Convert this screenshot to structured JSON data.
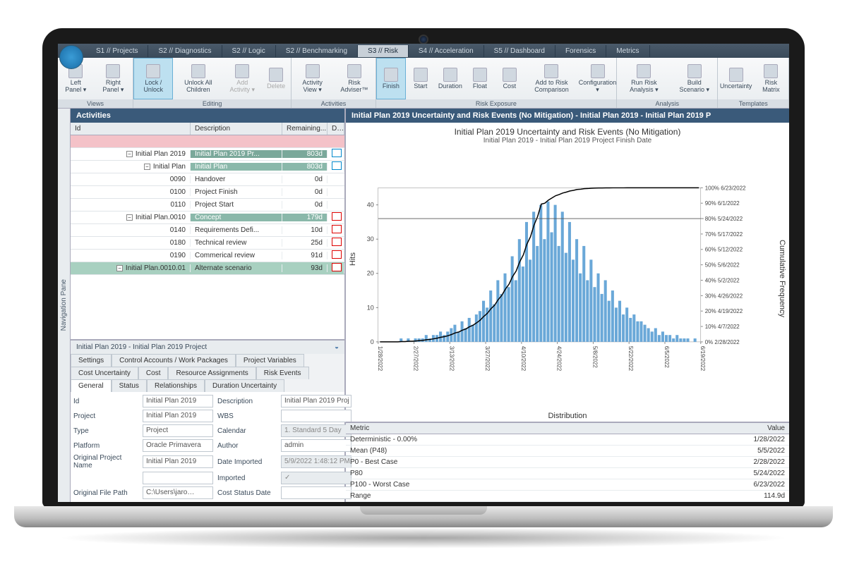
{
  "tabs": [
    "S1 // Projects",
    "S2 // Diagnostics",
    "S2 // Logic",
    "S2 // Benchmarking",
    "S3 // Risk",
    "S4 // Acceleration",
    "S5 // Dashboard",
    "Forensics",
    "Metrics"
  ],
  "active_tab": 4,
  "ribbon": {
    "groups": [
      {
        "label": "Views",
        "items": [
          {
            "t": "Left Panel ▾"
          },
          {
            "t": "Right Panel ▾"
          }
        ]
      },
      {
        "label": "Editing",
        "items": [
          {
            "t": "Lock / Unlock",
            "active": true
          },
          {
            "t": "Unlock All Children"
          },
          {
            "t": "Add Activity ▾",
            "disabled": true
          },
          {
            "t": "Delete",
            "disabled": true
          }
        ]
      },
      {
        "label": "Activities",
        "items": [
          {
            "t": "Activity View ▾"
          },
          {
            "t": "Risk Adviser™"
          }
        ]
      },
      {
        "label": "Risk Exposure",
        "items": [
          {
            "t": "Finish",
            "active": true
          },
          {
            "t": "Start"
          },
          {
            "t": "Duration"
          },
          {
            "t": "Float"
          },
          {
            "t": "Cost"
          },
          {
            "t": "Add to Risk Comparison"
          },
          {
            "t": "Configuration ▾"
          }
        ]
      },
      {
        "label": "Analysis",
        "items": [
          {
            "t": "Run Risk Analysis ▾"
          },
          {
            "t": "Build Scenario ▾"
          }
        ]
      },
      {
        "label": "Templates",
        "items": [
          {
            "t": "Uncertainty"
          },
          {
            "t": "Risk Matrix"
          }
        ]
      }
    ]
  },
  "activities": {
    "title": "Activities",
    "cols": [
      "Id",
      "Description",
      "Remaining...",
      "D…"
    ],
    "rows": [
      {
        "cls": "pink",
        "id": "",
        "desc": "",
        "rem": "",
        "ind": ""
      },
      {
        "cls": "summary",
        "indent": 0,
        "id": "Initial  Plan 2019",
        "desc": "Initial  Plan 2019 Pr...",
        "rem": "803d",
        "ind": "blue"
      },
      {
        "cls": "teal",
        "indent": 1,
        "id": "Initial  Plan",
        "desc": "Initial  Plan",
        "rem": "803d",
        "ind": "blue"
      },
      {
        "cls": "",
        "indent": 2,
        "id": "0090",
        "desc": "Handover",
        "rem": "0d",
        "ind": ""
      },
      {
        "cls": "",
        "indent": 2,
        "id": "0100",
        "desc": "Project Finish",
        "rem": "0d",
        "ind": ""
      },
      {
        "cls": "",
        "indent": 2,
        "id": "0110",
        "desc": "Project Start",
        "rem": "0d",
        "ind": ""
      },
      {
        "cls": "teal",
        "indent": 2,
        "id": "Initial  Plan.0010",
        "desc": "Concept",
        "rem": "179d",
        "ind": "red"
      },
      {
        "cls": "",
        "indent": 3,
        "id": "0140",
        "desc": "Requirements Defi...",
        "rem": "10d",
        "ind": "red"
      },
      {
        "cls": "",
        "indent": 3,
        "id": "0180",
        "desc": "Technical review",
        "rem": "25d",
        "ind": "red"
      },
      {
        "cls": "",
        "indent": 3,
        "id": "0190",
        "desc": "Commerical review",
        "rem": "91d",
        "ind": "red"
      },
      {
        "cls": "green",
        "indent": 3,
        "id": "Initial  Plan.0010.01",
        "desc": "Alternate scenario",
        "rem": "93d",
        "ind": "red"
      }
    ]
  },
  "details": {
    "title": "Initial  Plan 2019 - Initial  Plan 2019 Project",
    "tabrow1": [
      "Settings",
      "Control Accounts / Work Packages",
      "Project Variables"
    ],
    "tabrow2": [
      "Cost Uncertainty",
      "Cost",
      "Resource Assignments",
      "Risk Events"
    ],
    "tabrow3": [
      "General",
      "Status",
      "Relationships",
      "Duration Uncertainty"
    ],
    "active_tab": "General",
    "fields": [
      [
        "Id",
        "Initial  Plan 2019",
        "Description",
        "Initial  Plan 2019 Proj"
      ],
      [
        "Project",
        "Initial  Plan 2019",
        "WBS",
        ""
      ],
      [
        "Type",
        "Project",
        "Calendar",
        "1. Standard 5 Day"
      ],
      [
        "Platform",
        "Oracle Primavera",
        "Author",
        "admin"
      ],
      [
        "Original Project Name",
        "Initial  Plan 2019",
        "Date Imported",
        "5/9/2022 1:48:12 PM"
      ],
      [
        "",
        "",
        "Imported",
        "✓"
      ],
      [
        "Original File Path",
        "C:\\Users\\jaro…",
        "Cost Status Date",
        ""
      ]
    ]
  },
  "chart_panel_title": "Initial  Plan 2019 Uncertainty and Risk Events (No Mitigation) - Initial  Plan 2019 - Initial  Plan 2019 P",
  "chart_data": {
    "type": "histogram+cumulative",
    "title": "Initial  Plan 2019 Uncertainty and Risk Events (No Mitigation)",
    "subtitle": "Initial  Plan 2019 - Initial  Plan 2019 Project Finish Date",
    "xlabel": "Distribution",
    "ylabel": "Hits",
    "y2label": "Cumulative Frequency",
    "x_ticks": [
      "1/28/2022",
      "2/27/2022",
      "3/13/2022",
      "3/27/2022",
      "4/10/2022",
      "4/24/2022",
      "5/8/2022",
      "5/22/2022",
      "6/5/2022",
      "6/19/2022"
    ],
    "y_ticks": [
      0,
      10,
      20,
      30,
      40
    ],
    "y2_labels": [
      "100% 6/23/2022",
      "90% 6/1/2022",
      "80% 5/24/2022",
      "70% 5/17/2022",
      "60% 5/12/2022",
      "50% 5/6/2022",
      "40% 5/2/2022",
      "30% 4/26/2022",
      "20% 4/19/2022",
      "10% 4/7/2022",
      "0% 2/28/2022"
    ],
    "bars": [
      0,
      0,
      0,
      0,
      0,
      0,
      1,
      0,
      1,
      0,
      1,
      1,
      1,
      2,
      1,
      2,
      2,
      3,
      2,
      3,
      4,
      5,
      3,
      6,
      4,
      7,
      5,
      8,
      9,
      12,
      10,
      15,
      11,
      18,
      14,
      20,
      16,
      25,
      18,
      30,
      22,
      35,
      24,
      38,
      28,
      40,
      30,
      41,
      32,
      40,
      28,
      38,
      26,
      35,
      24,
      30,
      20,
      28,
      18,
      24,
      16,
      20,
      14,
      18,
      12,
      15,
      10,
      12,
      8,
      10,
      7,
      8,
      6,
      6,
      5,
      4,
      3,
      4,
      2,
      3,
      2,
      2,
      1,
      2,
      1,
      1,
      1,
      0,
      1,
      0
    ],
    "cumulative": [
      0,
      0,
      0,
      0,
      0,
      0,
      0.2,
      0.2,
      0.4,
      0.4,
      0.6,
      0.8,
      1.0,
      1.4,
      1.6,
      2.0,
      2.4,
      3.0,
      3.4,
      4.0,
      4.8,
      5.8,
      6.4,
      7.6,
      8.4,
      9.8,
      10.8,
      12.4,
      14.2,
      16.6,
      18.6,
      21.6,
      23.8,
      27.4,
      30.2,
      34.2,
      37.4,
      42.4,
      46.0,
      52.0,
      56.4,
      63.4,
      68.2,
      75.8,
      81.4,
      89.4,
      90.0,
      92.0,
      93.4,
      94.8,
      95.6,
      96.6,
      97.2,
      97.9,
      98.3,
      98.9,
      99.1,
      99.4,
      99.5,
      99.7,
      99.8,
      99.85,
      99.88,
      99.91,
      99.93,
      99.95,
      99.96,
      99.97,
      99.975,
      99.98,
      99.984,
      99.988,
      99.99,
      99.993,
      99.995,
      99.996,
      99.997,
      99.998,
      99.9985,
      99.999,
      99.9993,
      99.9996,
      99.9998,
      99.99985,
      99.9999,
      99.99993,
      99.99996,
      99.99998,
      100,
      100
    ]
  },
  "metrics": {
    "cols": [
      "Metric",
      "Value"
    ],
    "rows": [
      [
        "Deterministic - 0.00%",
        "1/28/2022"
      ],
      [
        "Mean (P48)",
        "5/5/2022"
      ],
      [
        "P0 - Best Case",
        "2/28/2022"
      ],
      [
        "P80",
        "5/24/2022"
      ],
      [
        "P100 - Worst Case",
        "6/23/2022"
      ],
      [
        "Range",
        "114.9d"
      ]
    ]
  },
  "nav_pane": "Navigation Pane"
}
